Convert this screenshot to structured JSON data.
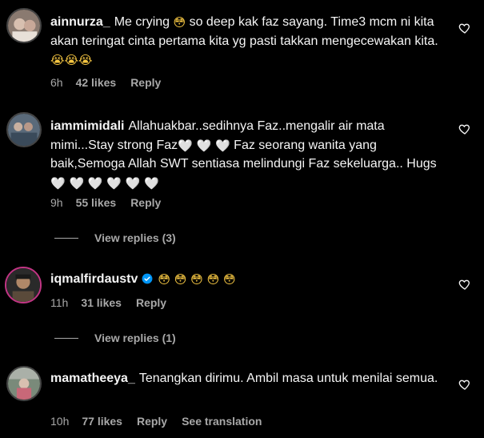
{
  "comments": [
    {
      "username": "ainnurza_",
      "text_parts": [
        "Me crying ",
        "😳",
        " so deep kak faz sayang. Time3 mcm ni kita akan teringat cinta pertama kita yg pasti takkan mengecewakan kita. ",
        "😭😭😭"
      ],
      "time": "6h",
      "likes": "42 likes",
      "reply": "Reply"
    },
    {
      "username": "iammimidali",
      "text_parts": [
        "Allahuakbar..sedihnya Faz..mengalir air mata mimi...Stay strong Faz",
        "🤍 🤍 🤍",
        " Faz seorang wanita yang baik,Semoga Allah SWT sentiasa melindungi Faz sekeluarga.. Hugs",
        "🤍 🤍 🤍 🤍 🤍 🤍"
      ],
      "time": "9h",
      "likes": "55 likes",
      "reply": "Reply",
      "view_replies": "View replies (3)"
    },
    {
      "username": "iqmalfirdaustv",
      "text_parts": [
        "",
        "😳 😳 😳 😳 😳"
      ],
      "time": "11h",
      "likes": "31 likes",
      "reply": "Reply",
      "view_replies": "View replies (1)"
    },
    {
      "username": "mamatheeya_",
      "text_parts": [
        "Tenangkan dirimu. Ambil masa untuk menilai semua."
      ],
      "time": "10h",
      "likes": "77 likes",
      "reply": "Reply",
      "see_translation": "See translation"
    }
  ],
  "icons": {
    "like": "heart-outline-icon",
    "verified": "verified-badge-icon"
  },
  "colors": {
    "background": "#000000",
    "text": "#f5f5f5",
    "secondary": "#a8a8a8",
    "verified": "#0095f6",
    "story_ring": "#c13584"
  }
}
